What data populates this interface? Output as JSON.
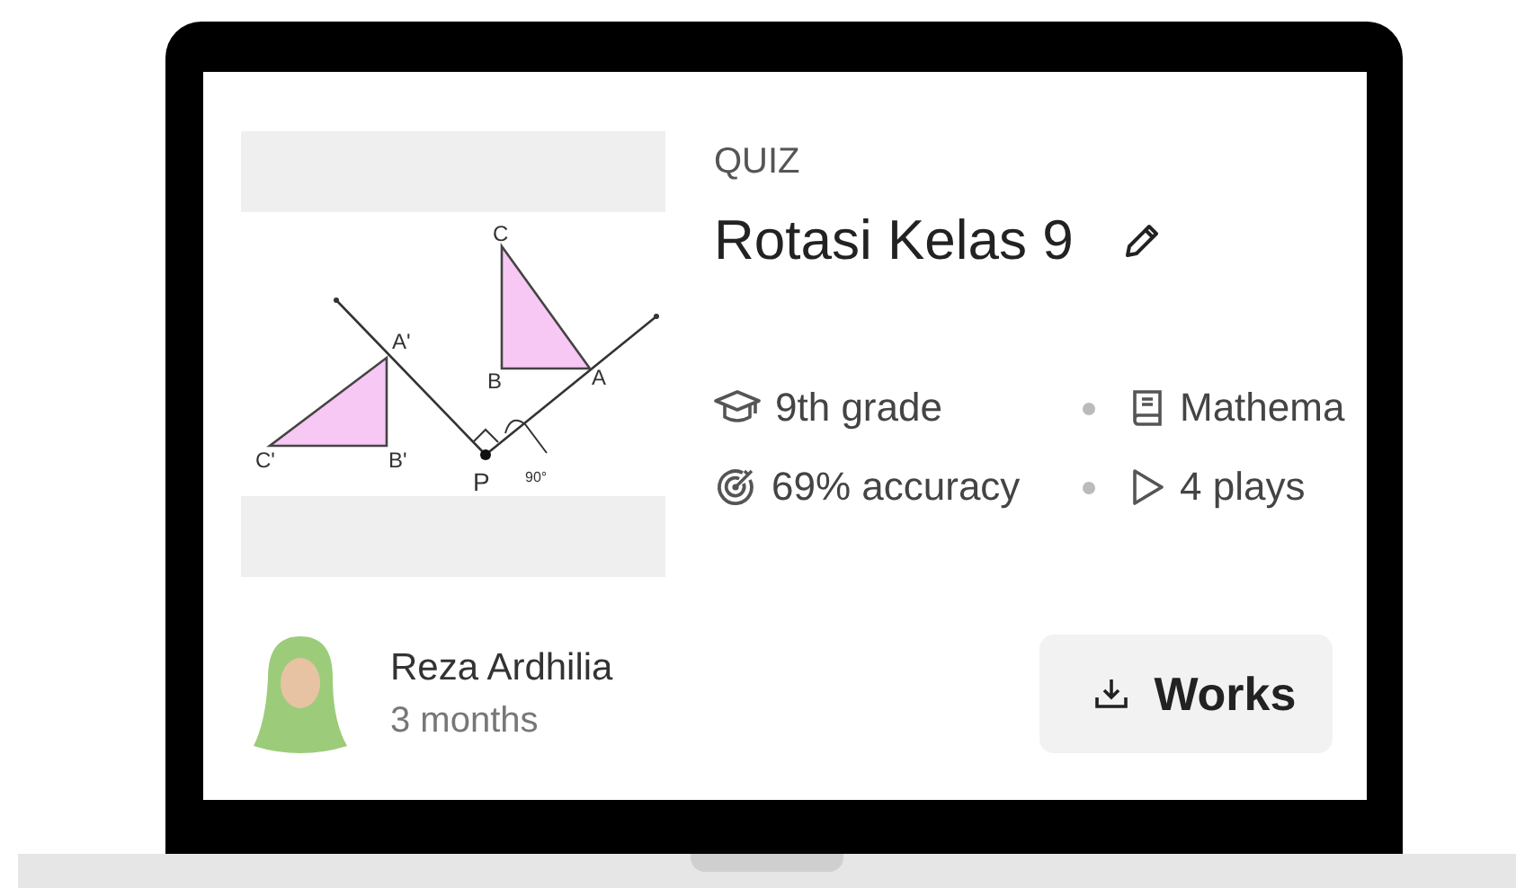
{
  "thumbnail": {
    "labels": [
      "C",
      "A'",
      "B",
      "A",
      "C'",
      "B'",
      "P",
      "90°"
    ]
  },
  "quiz": {
    "type": "QUIZ",
    "title": "Rotasi Kelas 9"
  },
  "meta": [
    {
      "kind": "grade",
      "text": "9th grade"
    },
    {
      "kind": "subject",
      "text": "Mathema"
    },
    {
      "kind": "accuracy",
      "text": "69% accuracy"
    },
    {
      "kind": "plays",
      "text": "4 plays"
    }
  ],
  "author": {
    "name": "Reza Ardhilia",
    "time": "3 months"
  },
  "worksheet_button": {
    "label": "Works"
  }
}
